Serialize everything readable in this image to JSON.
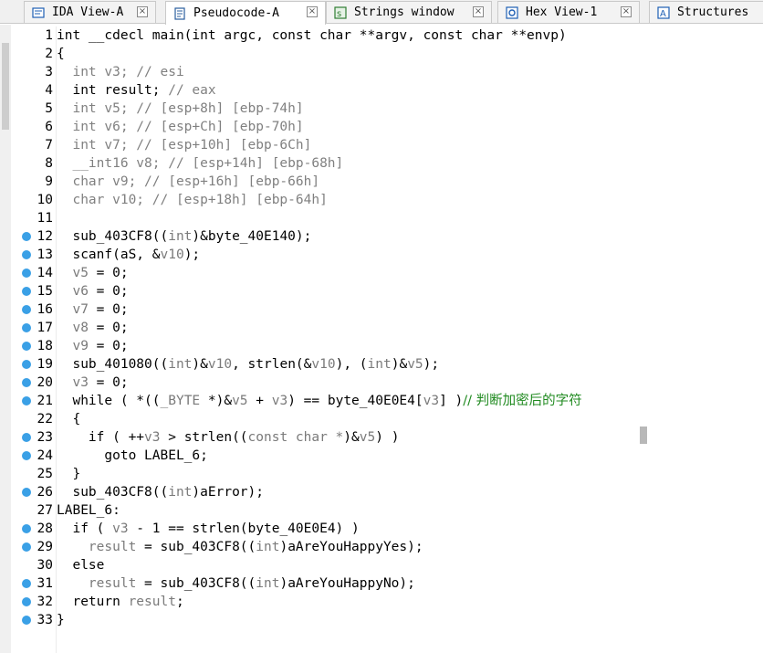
{
  "tabs": [
    {
      "label": "IDA View-A",
      "active": false,
      "icon": "ida-view-icon"
    },
    {
      "label": "Pseudocode-A",
      "active": true,
      "icon": "pseudocode-icon"
    },
    {
      "label": "Strings window",
      "active": false,
      "icon": "strings-icon"
    },
    {
      "label": "Hex View-1",
      "active": false,
      "icon": "hex-view-icon"
    },
    {
      "label": "Structures",
      "active": false,
      "icon": "structures-icon"
    }
  ],
  "close_symbol": "×",
  "breakpoint_color": "#3aa0e6",
  "code_lines": [
    {
      "n": "1",
      "bp": false,
      "segs": [
        [
          "int __cdecl main(int argc, const char **argv, const char **envp)",
          "kw"
        ]
      ]
    },
    {
      "n": "2",
      "bp": false,
      "segs": [
        [
          "{",
          "kw"
        ]
      ]
    },
    {
      "n": "3",
      "bp": false,
      "segs": [
        [
          "  int v3; // esi",
          "cm"
        ]
      ]
    },
    {
      "n": "4",
      "bp": false,
      "segs": [
        [
          "  int result; ",
          "kw"
        ],
        [
          "// eax",
          "cm"
        ]
      ]
    },
    {
      "n": "5",
      "bp": false,
      "segs": [
        [
          "  int v5; // [esp+8h] [ebp-74h]",
          "cm"
        ]
      ]
    },
    {
      "n": "6",
      "bp": false,
      "segs": [
        [
          "  int v6; // [esp+Ch] [ebp-70h]",
          "cm"
        ]
      ]
    },
    {
      "n": "7",
      "bp": false,
      "segs": [
        [
          "  int v7; // [esp+10h] [ebp-6Ch]",
          "cm"
        ]
      ]
    },
    {
      "n": "8",
      "bp": false,
      "segs": [
        [
          "  __int16 v8; // [esp+14h] [ebp-68h]",
          "cm"
        ]
      ]
    },
    {
      "n": "9",
      "bp": false,
      "segs": [
        [
          "  char v9; // [esp+16h] [ebp-66h]",
          "cm"
        ]
      ]
    },
    {
      "n": "10",
      "bp": false,
      "segs": [
        [
          "  char v10; // [esp+18h] [ebp-64h]",
          "cm"
        ]
      ]
    },
    {
      "n": "11",
      "bp": false,
      "segs": [
        [
          "",
          "kw"
        ]
      ]
    },
    {
      "n": "12",
      "bp": true,
      "segs": [
        [
          "  sub_403CF8((",
          "kw"
        ],
        [
          "int",
          "var"
        ],
        [
          ")&byte_40E140);",
          "kw"
        ]
      ]
    },
    {
      "n": "13",
      "bp": true,
      "segs": [
        [
          "  scanf(aS, &",
          "kw"
        ],
        [
          "v10",
          "var"
        ],
        [
          ");",
          "kw"
        ]
      ]
    },
    {
      "n": "14",
      "bp": true,
      "segs": [
        [
          "  ",
          "kw"
        ],
        [
          "v5",
          "var"
        ],
        [
          " = 0;",
          "kw"
        ]
      ]
    },
    {
      "n": "15",
      "bp": true,
      "segs": [
        [
          "  ",
          "kw"
        ],
        [
          "v6",
          "var"
        ],
        [
          " = 0;",
          "kw"
        ]
      ]
    },
    {
      "n": "16",
      "bp": true,
      "segs": [
        [
          "  ",
          "kw"
        ],
        [
          "v7",
          "var"
        ],
        [
          " = 0;",
          "kw"
        ]
      ]
    },
    {
      "n": "17",
      "bp": true,
      "segs": [
        [
          "  ",
          "kw"
        ],
        [
          "v8",
          "var"
        ],
        [
          " = 0;",
          "kw"
        ]
      ]
    },
    {
      "n": "18",
      "bp": true,
      "segs": [
        [
          "  ",
          "kw"
        ],
        [
          "v9",
          "var"
        ],
        [
          " = 0;",
          "kw"
        ]
      ]
    },
    {
      "n": "19",
      "bp": true,
      "segs": [
        [
          "  sub_401080((",
          "kw"
        ],
        [
          "int",
          "var"
        ],
        [
          ")&",
          "kw"
        ],
        [
          "v10",
          "var"
        ],
        [
          ", strlen(&",
          "kw"
        ],
        [
          "v10",
          "var"
        ],
        [
          "), (",
          "kw"
        ],
        [
          "int",
          "var"
        ],
        [
          ")&",
          "kw"
        ],
        [
          "v5",
          "var"
        ],
        [
          ");",
          "kw"
        ]
      ]
    },
    {
      "n": "20",
      "bp": true,
      "segs": [
        [
          "  ",
          "kw"
        ],
        [
          "v3",
          "var"
        ],
        [
          " = 0;",
          "kw"
        ]
      ]
    },
    {
      "n": "21",
      "bp": true,
      "segs": [
        [
          "  while ( *((",
          "kw"
        ],
        [
          "_BYTE",
          "var"
        ],
        [
          " *)&",
          "kw"
        ],
        [
          "v5",
          "var"
        ],
        [
          " + ",
          "kw"
        ],
        [
          "v3",
          "var"
        ],
        [
          ") == byte_40E0E4[",
          "kw"
        ],
        [
          "v3",
          "var"
        ],
        [
          "] )",
          "kw"
        ],
        [
          "// 判断加密后的字符",
          "cn"
        ]
      ]
    },
    {
      "n": "22",
      "bp": false,
      "segs": [
        [
          "  {",
          "kw"
        ]
      ]
    },
    {
      "n": "23",
      "bp": true,
      "segs": [
        [
          "    if ( ++",
          "kw"
        ],
        [
          "v3",
          "var"
        ],
        [
          " > strlen((",
          "kw"
        ],
        [
          "const char *",
          "var"
        ],
        [
          ")&",
          "kw"
        ],
        [
          "v5",
          "var"
        ],
        [
          ") )",
          "kw"
        ]
      ]
    },
    {
      "n": "24",
      "bp": true,
      "segs": [
        [
          "      goto LABEL_6;",
          "kw"
        ]
      ]
    },
    {
      "n": "25",
      "bp": false,
      "segs": [
        [
          "  }",
          "kw"
        ]
      ]
    },
    {
      "n": "26",
      "bp": true,
      "segs": [
        [
          "  sub_403CF8((",
          "kw"
        ],
        [
          "int",
          "var"
        ],
        [
          ")aError);",
          "kw"
        ]
      ]
    },
    {
      "n": "27",
      "bp": false,
      "segs": [
        [
          "LABEL_6:",
          "kw"
        ]
      ]
    },
    {
      "n": "28",
      "bp": true,
      "segs": [
        [
          "  if ( ",
          "kw"
        ],
        [
          "v3",
          "var"
        ],
        [
          " - 1 == strlen(byte_40E0E4) )",
          "kw"
        ]
      ]
    },
    {
      "n": "29",
      "bp": true,
      "segs": [
        [
          "    ",
          "kw"
        ],
        [
          "result",
          "var"
        ],
        [
          " = sub_403CF8((",
          "kw"
        ],
        [
          "int",
          "var"
        ],
        [
          ")aAreYouHappyYes);",
          "kw"
        ]
      ]
    },
    {
      "n": "30",
      "bp": false,
      "segs": [
        [
          "  else",
          "kw"
        ]
      ]
    },
    {
      "n": "31",
      "bp": true,
      "segs": [
        [
          "    ",
          "kw"
        ],
        [
          "result",
          "var"
        ],
        [
          " = sub_403CF8((",
          "kw"
        ],
        [
          "int",
          "var"
        ],
        [
          ")aAreYouHappyNo);",
          "kw"
        ]
      ]
    },
    {
      "n": "32",
      "bp": true,
      "segs": [
        [
          "  return ",
          "kw"
        ],
        [
          "result",
          "var"
        ],
        [
          ";",
          "kw"
        ]
      ]
    },
    {
      "n": "33",
      "bp": true,
      "segs": [
        [
          "}",
          "kw"
        ]
      ]
    }
  ]
}
